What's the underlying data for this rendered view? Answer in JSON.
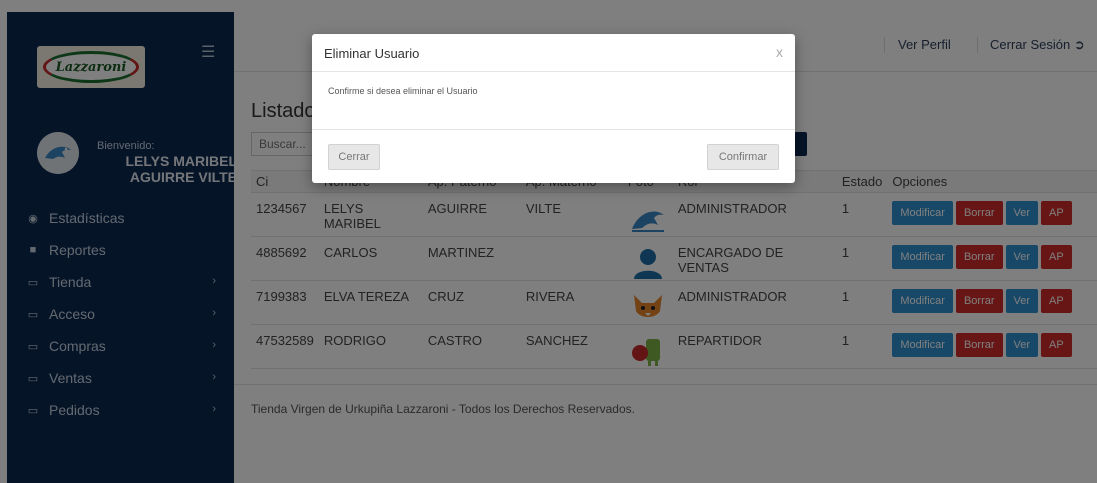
{
  "app": {
    "logo_text": "Lazzaroni"
  },
  "sidebar": {
    "welcome": "Bienvenido:",
    "user_name": "LELYS MARIBEL AGUIRRE VILTE",
    "items": [
      {
        "label": "Estadísticas",
        "icon": "dashboard-icon",
        "chevron": false
      },
      {
        "label": "Reportes",
        "icon": "folder-icon",
        "chevron": false
      },
      {
        "label": "Tienda",
        "icon": "laptop-icon",
        "chevron": true
      },
      {
        "label": "Acceso",
        "icon": "laptop-icon",
        "chevron": true
      },
      {
        "label": "Compras",
        "icon": "laptop-icon",
        "chevron": true
      },
      {
        "label": "Ventas",
        "icon": "laptop-icon",
        "chevron": true
      },
      {
        "label": "Pedidos",
        "icon": "laptop-icon",
        "chevron": true
      }
    ]
  },
  "topbar": {
    "profile_label": "Ver Perfil",
    "logout_label": "Cerrar Sesión"
  },
  "main": {
    "title": "Listado de Usuarios",
    "search_placeholder": "Buscar...",
    "columns": [
      "Ci",
      "Nombre",
      "Ap. Paterno",
      "Ap. Materno",
      "Foto",
      "Rol",
      "Estado",
      "Opciones"
    ],
    "rows": [
      {
        "ci": "1234567",
        "nombre": "LELYS MARIBEL",
        "paterno": "AGUIRRE",
        "materno": "VILTE",
        "foto": "dolphin",
        "rol": "ADMINISTRADOR",
        "estado": "1"
      },
      {
        "ci": "4885692",
        "nombre": "CARLOS",
        "paterno": "MARTINEZ",
        "materno": "",
        "foto": "person",
        "rol": "ENCARGADO DE VENTAS",
        "estado": "1"
      },
      {
        "ci": "7199383",
        "nombre": "ELVA TEREZA",
        "paterno": "CRUZ",
        "materno": "RIVERA",
        "foto": "fox",
        "rol": "ADMINISTRADOR",
        "estado": "1"
      },
      {
        "ci": "47532589",
        "nombre": "RODRIGO",
        "paterno": "CASTRO",
        "materno": "SANCHEZ",
        "foto": "android",
        "rol": "REPARTIDOR",
        "estado": "1"
      }
    ],
    "actions": {
      "modify": "Modificar",
      "delete": "Borrar",
      "view": "Ver",
      "ap": "AP"
    },
    "footer": "Tienda Virgen de Urkupiña Lazzaroni - Todos los Derechos Reservados."
  },
  "modal": {
    "title": "Eliminar Usuario",
    "close_glyph": "x",
    "body": "Confirme si desea eliminar el Usuario",
    "cancel_label": "Cerrar",
    "confirm_label": "Confirmar"
  },
  "colors": {
    "sidebar_bg": "#0c2950",
    "button_blue": "#3190cf",
    "button_red": "#cf2d2b"
  }
}
